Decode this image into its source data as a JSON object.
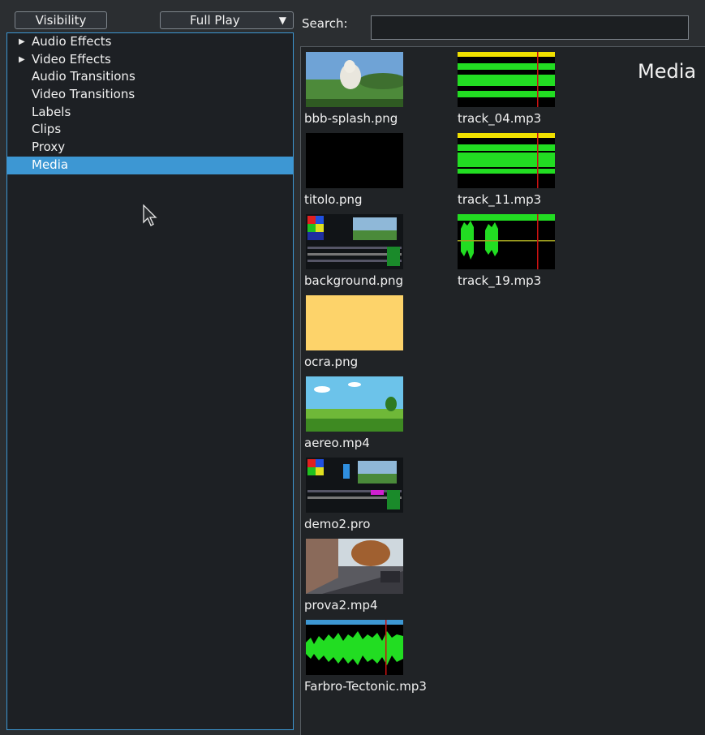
{
  "toolbar": {
    "visibility_label": "Visibility",
    "playmode_value": "Full Play"
  },
  "tree": {
    "items": [
      {
        "label": "Audio Effects",
        "expandable": true
      },
      {
        "label": "Video Effects",
        "expandable": true
      },
      {
        "label": "Audio Transitions",
        "expandable": false
      },
      {
        "label": "Video Transitions",
        "expandable": false
      },
      {
        "label": "Labels",
        "expandable": false
      },
      {
        "label": "Clips",
        "expandable": false
      },
      {
        "label": "Proxy",
        "expandable": false
      },
      {
        "label": "Media",
        "expandable": false,
        "selected": true
      }
    ]
  },
  "search": {
    "label": "Search:",
    "value": ""
  },
  "media": {
    "title": "Media",
    "items": [
      {
        "name": "bbb-splash.png",
        "kind": "image"
      },
      {
        "name": "titolo.png",
        "kind": "image"
      },
      {
        "name": "background.png",
        "kind": "image"
      },
      {
        "name": "ocra.png",
        "kind": "image"
      },
      {
        "name": "aereo.mp4",
        "kind": "video"
      },
      {
        "name": "demo2.pro",
        "kind": "project"
      },
      {
        "name": "prova2.mp4",
        "kind": "video"
      },
      {
        "name": "Farbro-Tectonic.mp3",
        "kind": "audio"
      },
      {
        "name": "track_04.mp3",
        "kind": "audio"
      },
      {
        "name": "track_11.mp3",
        "kind": "audio"
      },
      {
        "name": "track_19.mp3",
        "kind": "audio"
      }
    ]
  },
  "colors": {
    "selection": "#3d97d3",
    "waveform": "#22dd22",
    "playhead": "#cc1111",
    "ocra": "#fdd36a"
  }
}
